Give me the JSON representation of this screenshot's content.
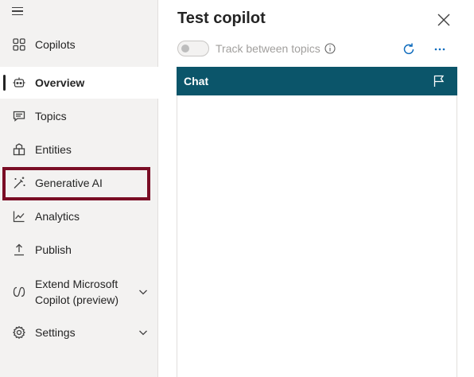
{
  "sidebar": {
    "items": [
      {
        "id": "copilots",
        "label": "Copilots",
        "icon": "grid-icon"
      },
      {
        "id": "overview",
        "label": "Overview",
        "icon": "bot-icon",
        "active": true
      },
      {
        "id": "topics",
        "label": "Topics",
        "icon": "chat-bubble-icon"
      },
      {
        "id": "entities",
        "label": "Entities",
        "icon": "shapes-icon"
      },
      {
        "id": "generative-ai",
        "label": "Generative AI",
        "icon": "magic-wand-icon",
        "highlighted": true
      },
      {
        "id": "analytics",
        "label": "Analytics",
        "icon": "line-chart-icon"
      },
      {
        "id": "publish",
        "label": "Publish",
        "icon": "upload-icon"
      },
      {
        "id": "extend-copilot",
        "label": "Extend Microsoft Copilot (preview)",
        "icon": "copilot-icon",
        "expandable": true
      },
      {
        "id": "settings",
        "label": "Settings",
        "icon": "gear-icon",
        "expandable": true
      }
    ]
  },
  "panel": {
    "title": "Test copilot",
    "toggle_label": "Track between topics",
    "toggle_on": false,
    "chat_title": "Chat"
  },
  "colors": {
    "chat_header": "#0b556a",
    "highlight": "#7a0d25",
    "sidebar_bg": "#f3f2f1"
  }
}
